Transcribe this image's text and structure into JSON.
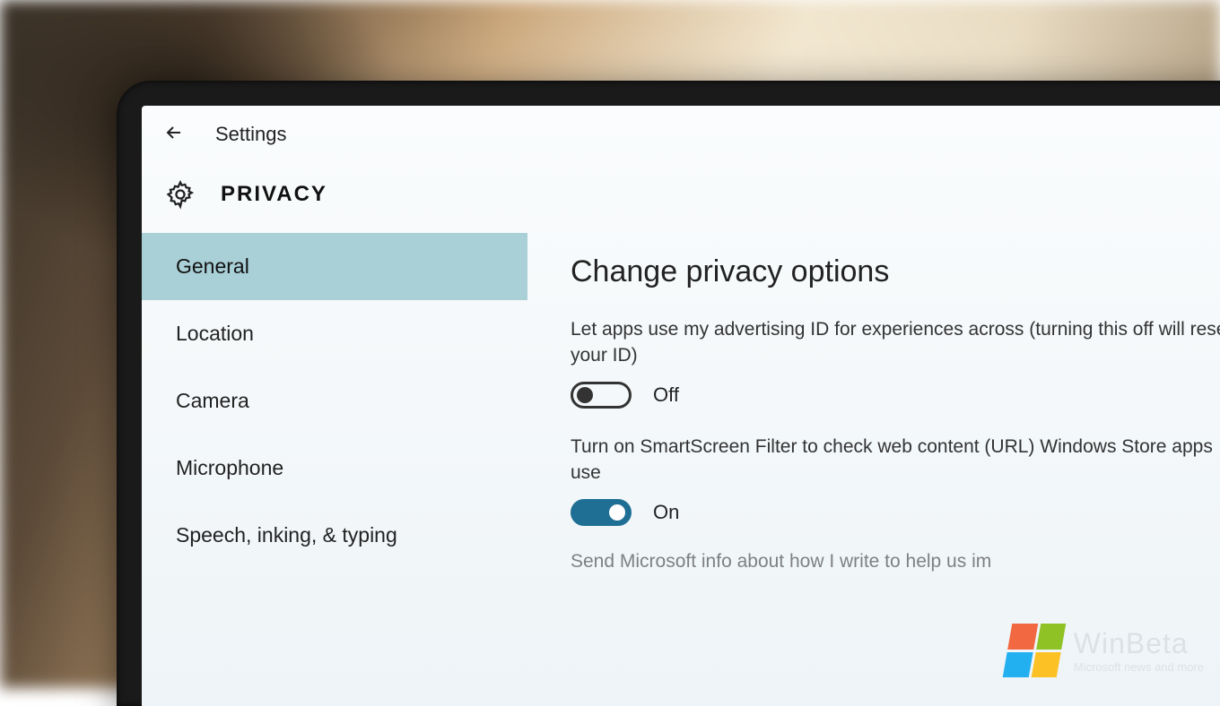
{
  "titlebar": {
    "label": "Settings"
  },
  "page": {
    "title": "PRIVACY"
  },
  "sidebar": {
    "items": [
      {
        "label": "General",
        "selected": true
      },
      {
        "label": "Location",
        "selected": false
      },
      {
        "label": "Camera",
        "selected": false
      },
      {
        "label": "Microphone",
        "selected": false
      },
      {
        "label": "Speech, inking, & typing",
        "selected": false
      }
    ]
  },
  "content": {
    "heading": "Change privacy options",
    "options": [
      {
        "description": "Let apps use my advertising ID for experiences across (turning this off will reset your ID)",
        "state_label": "Off",
        "state_on": false
      },
      {
        "description": "Turn on SmartScreen Filter to check web content (URL) Windows Store apps use",
        "state_label": "On",
        "state_on": true
      }
    ],
    "truncated_next": "Send Microsoft info about how I write to help us im"
  },
  "watermark": {
    "brand": "WinBeta",
    "tagline": "Microsoft news and more"
  }
}
